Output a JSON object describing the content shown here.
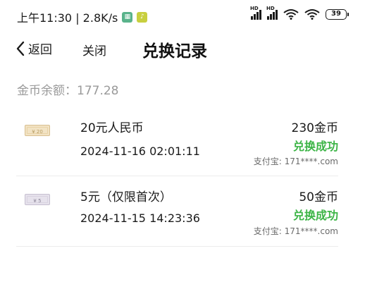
{
  "status_bar": {
    "time_speed": "上午11:30 | 2.8K/s",
    "hd1": "HD",
    "hd2": "HD",
    "battery": "39"
  },
  "nav": {
    "back_label": "返回",
    "close_label": "关闭",
    "title": "兑换记录"
  },
  "balance_text": "金币余额：177.28",
  "records": [
    {
      "ticket_label": "¥ 20",
      "name": "20元人民币",
      "time": "2024-11-16 02:01:11",
      "coins": "230金币",
      "status": "兑换成功",
      "account": "支付宝: 171****.com"
    },
    {
      "ticket_label": "¥ 5",
      "name": "5元（仅限首次）",
      "time": "2024-11-15 14:23:36",
      "coins": "50金币",
      "status": "兑换成功",
      "account": "支付宝: 171****.com"
    }
  ],
  "colors": {
    "success": "#3db547",
    "muted": "#9a9a9a"
  }
}
